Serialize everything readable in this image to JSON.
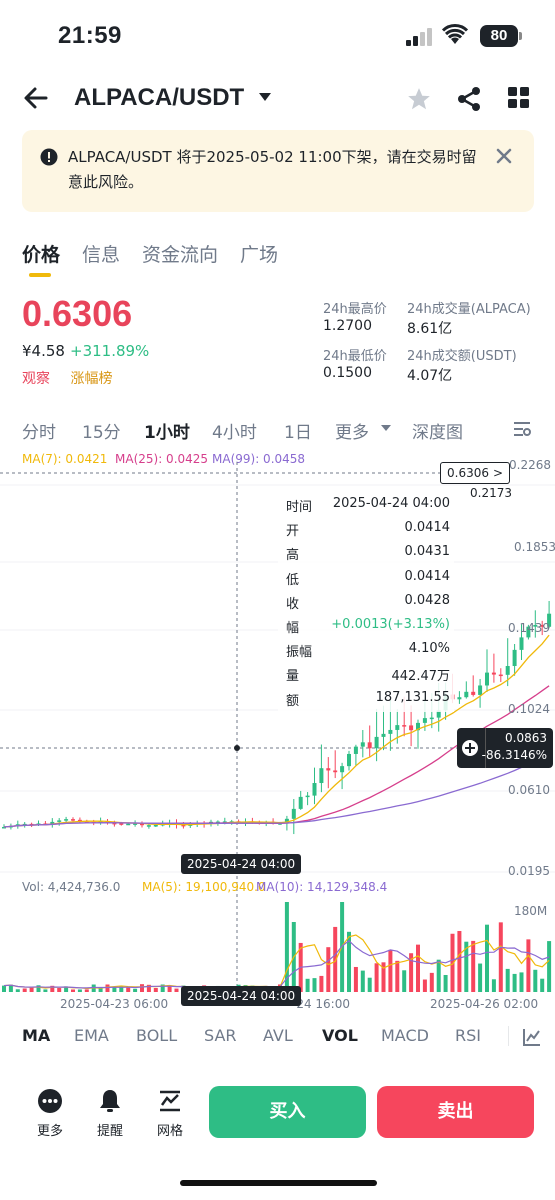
{
  "status": {
    "time": "21:59",
    "battery": "80"
  },
  "header": {
    "pair": "ALPACA/USDT"
  },
  "notice": {
    "text": "ALPACA/USDT 将于2025-05-02 11:00下架，请在交易时留意此风险。"
  },
  "tabs": [
    "价格",
    "信息",
    "资金流向",
    "广场"
  ],
  "price": {
    "last": "0.6306",
    "cny": "¥4.58",
    "change": "+311.89%",
    "tag_watch": "观察",
    "tag_gain": "涨幅榜"
  },
  "stats": {
    "high_label": "24h最高价",
    "high": "1.2700",
    "vol_base_label": "24h成交量(ALPACA)",
    "vol_base": "8.61亿",
    "low_label": "24h最低价",
    "low": "0.1500",
    "vol_quote_label": "24h成交额(USDT)",
    "vol_quote": "4.07亿"
  },
  "intervals": [
    "分时",
    "15分",
    "1小时",
    "4小时",
    "1日",
    "更多",
    "深度图"
  ],
  "ma_legend": {
    "ma7": "MA(7): 0.0421",
    "ma25": "MA(25): 0.0425",
    "ma99": "MA(99): 0.0458"
  },
  "colors": {
    "up": "#2ebd85",
    "down": "#f6465d",
    "ma7": "#f0b90b",
    "ma25": "#d63f8c",
    "ma99": "#8a6ad1"
  },
  "tooltip": {
    "rows": [
      {
        "k": "时间",
        "v": "2025-04-24 04:00"
      },
      {
        "k": "开",
        "v": "0.0414"
      },
      {
        "k": "高",
        "v": "0.0431"
      },
      {
        "k": "低",
        "v": "0.0414"
      },
      {
        "k": "收",
        "v": "0.0428"
      },
      {
        "k": "幅",
        "v": "+0.0013(+3.13%)"
      },
      {
        "k": "振幅",
        "v": "4.10%"
      },
      {
        "k": "量",
        "v": "442.47万"
      },
      {
        "k": "额",
        "v": "187,131.55"
      }
    ]
  },
  "price_tag": {
    "value": "0.6306",
    "arrow": ">"
  },
  "cursor_tag": {
    "price": "0.0863",
    "pct": "-86.3146%"
  },
  "price_axis": [
    "0.2268",
    "0.2173",
    "0.1853",
    "0.1439",
    "0.1024",
    "0.0610",
    "0.0195"
  ],
  "cursor_date": "2025-04-24 04:00",
  "vol_legend": {
    "vol": "Vol: 4,424,736.0",
    "ma5": "MA(5): 19,100,940.0",
    "ma10": "MA(10): 14,129,348.4"
  },
  "vol_axis": "180M",
  "date_axis": [
    "2025-04-23 06:00",
    "-24 16:00",
    "2025-04-26 02:00"
  ],
  "indicators": [
    "MA",
    "EMA",
    "BOLL",
    "SAR",
    "AVL",
    "VOL",
    "MACD",
    "RSI"
  ],
  "bottom": {
    "more": "更多",
    "alert": "提醒",
    "grid": "网格",
    "buy": "买入",
    "sell": "卖出"
  }
}
